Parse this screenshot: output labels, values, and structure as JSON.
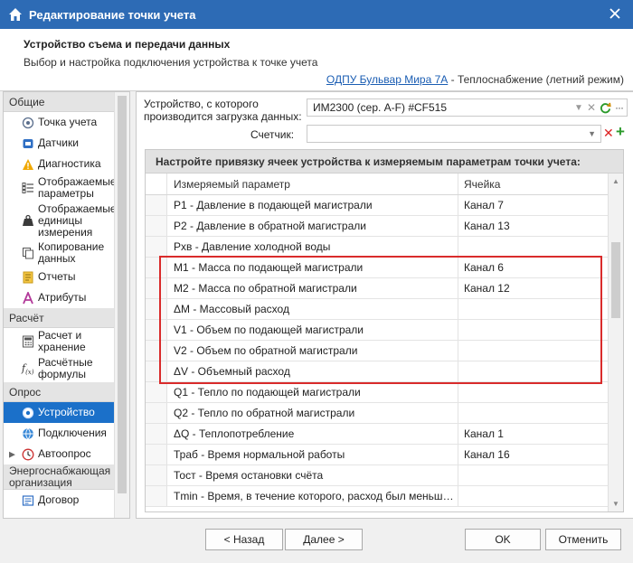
{
  "window": {
    "title": "Редактирование точки учета"
  },
  "header": {
    "title": "Устройство съема и передачи данных",
    "subtitle": "Выбор и настройка подключения устройства к точке учета",
    "link_text": "ОДПУ Бульвар Мира 7А",
    "link_suffix": " - Теплоснабжение (летний режим)"
  },
  "sidebar": {
    "groups": [
      {
        "label": "Общие",
        "items": [
          {
            "label": "Точка учета",
            "icon": "target-icon"
          },
          {
            "label": "Датчики",
            "icon": "sensor-icon"
          },
          {
            "label": "Диагностика",
            "icon": "warning-icon"
          },
          {
            "label": "Отображаемые параметры",
            "icon": "checklist-icon"
          },
          {
            "label": "Отображаемые единицы измерения",
            "icon": "weight-icon"
          },
          {
            "label": "Копирование данных",
            "icon": "copy-icon"
          },
          {
            "label": "Отчеты",
            "icon": "report-icon"
          },
          {
            "label": "Атрибуты",
            "icon": "attribute-icon"
          }
        ]
      },
      {
        "label": "Расчёт",
        "items": [
          {
            "label": "Расчет и хранение",
            "icon": "calc-icon"
          },
          {
            "label": "Расчётные формулы",
            "icon": "formula-icon"
          }
        ]
      },
      {
        "label": "Опрос",
        "items": [
          {
            "label": "Устройство",
            "icon": "device-icon"
          },
          {
            "label": "Подключения",
            "icon": "globe-icon"
          },
          {
            "label": "Автоопрос",
            "icon": "clock-icon"
          }
        ]
      },
      {
        "label": "Энергоснабжающая организация",
        "items": [
          {
            "label": "Договор",
            "icon": "contract-icon"
          }
        ]
      }
    ]
  },
  "device": {
    "label": "Устройство, с которого производится загрузка данных:",
    "value": "ИМ2300 (сер. A-F) #CF515"
  },
  "counter": {
    "label": "Счетчик:",
    "value": ""
  },
  "grid": {
    "title": "Настройте привязку ячеек устройства к измеряемым параметрам точки учета:",
    "columns": [
      "Измеряемый параметр",
      "Ячейка"
    ],
    "rows": [
      {
        "param": "P1 - Давление в подающей магистрали",
        "cell": "Канал 7"
      },
      {
        "param": "P2 - Давление в обратной магистрали",
        "cell": "Канал 13"
      },
      {
        "param": "Pхв - Давление холодной воды",
        "cell": ""
      },
      {
        "param": "M1 - Масса по подающей магистрали",
        "cell": "Канал 6"
      },
      {
        "param": "M2 - Масса по обратной магистрали",
        "cell": "Канал 12"
      },
      {
        "param": "ΔM - Массовый расход",
        "cell": ""
      },
      {
        "param": "V1 - Объем по подающей магистрали",
        "cell": ""
      },
      {
        "param": "V2 - Объем по обратной магистрали",
        "cell": ""
      },
      {
        "param": "ΔV - Объемный расход",
        "cell": ""
      },
      {
        "param": "Q1 - Тепло по подающей магистрали",
        "cell": ""
      },
      {
        "param": "Q2 - Тепло по обратной магистрали",
        "cell": ""
      },
      {
        "param": "ΔQ - Теплопотребление",
        "cell": "Канал 1"
      },
      {
        "param": "Траб - Время нормальной работы",
        "cell": "Канал 16"
      },
      {
        "param": "Тост - Время остановки счёта",
        "cell": ""
      },
      {
        "param": "Tmin - Время, в течение которого, расход был меньше минимального",
        "cell": ""
      }
    ]
  },
  "buttons": {
    "back": "< Назад",
    "next": "Далее >",
    "ok": "OK",
    "cancel": "Отменить"
  },
  "colors": {
    "titlebar": "#2d6bb5",
    "selection": "#1b70c9",
    "highlight": "#d92b2b",
    "link": "#1a5db3"
  }
}
